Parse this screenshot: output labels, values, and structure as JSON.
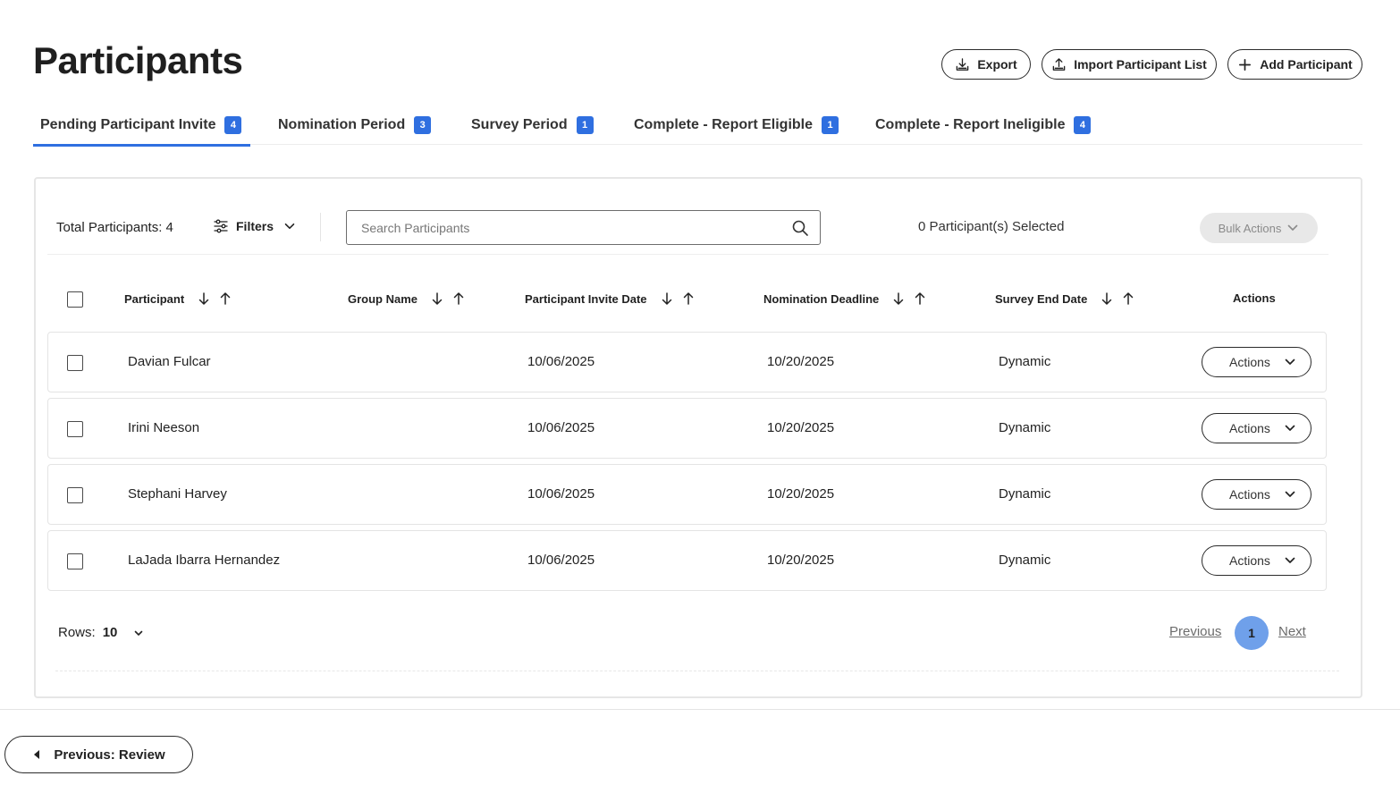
{
  "page": {
    "title": "Participants"
  },
  "header_actions": {
    "export_label": "Export",
    "import_label": "Import Participant List",
    "add_label": "Add Participant"
  },
  "tabs": [
    {
      "label": "Pending Participant Invite",
      "count": "4",
      "active": true
    },
    {
      "label": "Nomination Period",
      "count": "3",
      "active": false
    },
    {
      "label": "Survey Period",
      "count": "1",
      "active": false
    },
    {
      "label": "Complete - Report Eligible",
      "count": "1",
      "active": false
    },
    {
      "label": "Complete - Report Ineligible",
      "count": "4",
      "active": false
    }
  ],
  "toolbar": {
    "total": "Total Participants: 4",
    "filters_label": "Filters",
    "search_placeholder": "Search Participants",
    "selected_text": "0 Participant(s) Selected",
    "bulk_label": "Bulk Actions"
  },
  "table": {
    "columns": [
      "Participant",
      "Group Name",
      "Participant Invite Date",
      "Nomination Deadline",
      "Survey End Date",
      "Actions"
    ],
    "rows": [
      {
        "participant": "Davian Fulcar",
        "group": "",
        "invite_date": "10/06/2025",
        "nomination_deadline": "10/20/2025",
        "survey_end": "Dynamic",
        "action_label": "Actions"
      },
      {
        "participant": "Irini Neeson",
        "group": "",
        "invite_date": "10/06/2025",
        "nomination_deadline": "10/20/2025",
        "survey_end": "Dynamic",
        "action_label": "Actions"
      },
      {
        "participant": "Stephani Harvey",
        "group": "",
        "invite_date": "10/06/2025",
        "nomination_deadline": "10/20/2025",
        "survey_end": "Dynamic",
        "action_label": "Actions"
      },
      {
        "participant": "LaJada Ibarra Hernandez",
        "group": "",
        "invite_date": "10/06/2025",
        "nomination_deadline": "10/20/2025",
        "survey_end": "Dynamic",
        "action_label": "Actions"
      }
    ]
  },
  "pagination": {
    "rows_label": "Rows:",
    "rows_value": "10",
    "previous": "Previous",
    "current_page": "1",
    "next": "Next"
  },
  "footer": {
    "previous_step": "Previous: Review"
  },
  "colors": {
    "accent": "#2f6fe0",
    "current_page": "#6fa0ea",
    "bulk_bg": "#e8e8e8"
  }
}
